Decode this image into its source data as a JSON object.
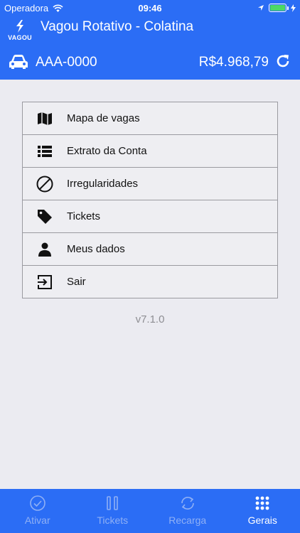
{
  "status": {
    "carrier": "Operadora",
    "time": "09:46"
  },
  "header": {
    "logo_text": "VAGOU",
    "title": "Vagou Rotativo - Colatina",
    "plate": "AAA-0000",
    "balance": "R$4.968,79"
  },
  "menu": [
    {
      "label": "Mapa de vagas",
      "icon": "map-icon"
    },
    {
      "label": "Extrato da Conta",
      "icon": "list-icon"
    },
    {
      "label": "Irregularidades",
      "icon": "prohibited-icon"
    },
    {
      "label": "Tickets",
      "icon": "tag-icon"
    },
    {
      "label": "Meus dados",
      "icon": "person-icon"
    },
    {
      "label": "Sair",
      "icon": "exit-icon"
    }
  ],
  "version": "v7.1.0",
  "tabs": [
    {
      "label": "Ativar",
      "icon": "check-circle-icon",
      "active": false
    },
    {
      "label": "Tickets",
      "icon": "tickets-icon",
      "active": false
    },
    {
      "label": "Recarga",
      "icon": "recharge-icon",
      "active": false
    },
    {
      "label": "Gerais",
      "icon": "grid-icon",
      "active": true
    }
  ],
  "colors": {
    "primary": "#2b6df5",
    "background": "#ebebf1",
    "tab_inactive": "#8fb0f5"
  }
}
